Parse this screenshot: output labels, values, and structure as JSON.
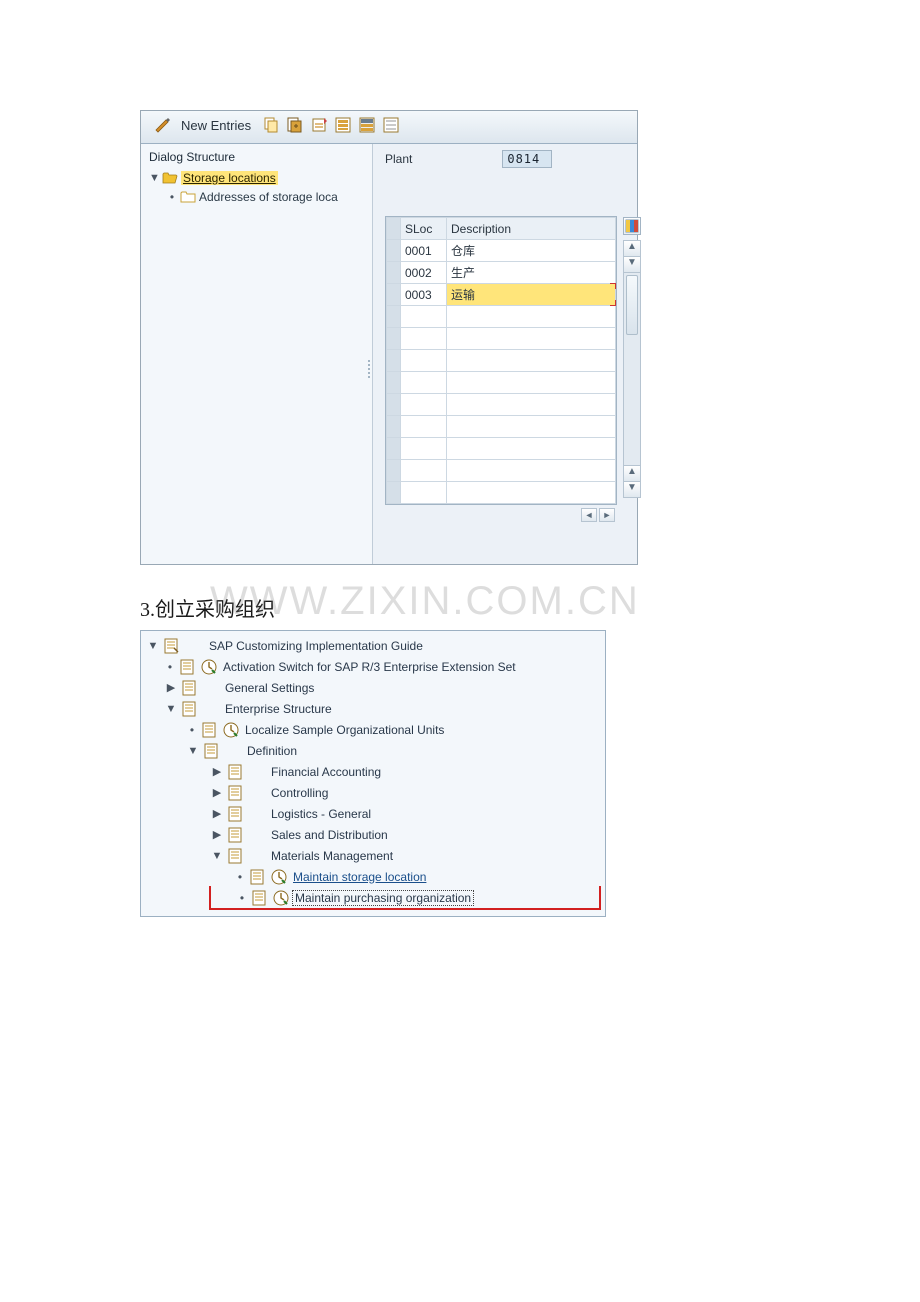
{
  "toolbar": {
    "new_entries_label": "New Entries"
  },
  "dialog_structure": {
    "title": "Dialog Structure",
    "root": "Storage locations",
    "child": "Addresses of storage loca"
  },
  "form": {
    "plant_label": "Plant",
    "plant_value": "0814"
  },
  "table": {
    "col_sloc": "SLoc",
    "col_desc": "Description",
    "rows": [
      {
        "sloc": "0001",
        "desc": "仓库"
      },
      {
        "sloc": "0002",
        "desc": "生产"
      },
      {
        "sloc": "0003",
        "desc": "运输"
      }
    ]
  },
  "section3": {
    "number": "3.",
    "title": "创立采购组织"
  },
  "watermark": "WWW.ZIXIN.COM.CN",
  "img_tree": {
    "n0": "SAP Customizing Implementation Guide",
    "n1": "Activation Switch for SAP R/3 Enterprise Extension Set",
    "n2": "General Settings",
    "n3": "Enterprise Structure",
    "n4": "Localize Sample Organizational Units",
    "n5": "Definition",
    "n6": "Financial Accounting",
    "n7": "Controlling",
    "n8": "Logistics - General",
    "n9": "Sales and Distribution",
    "n10": "Materials Management",
    "n11": "Maintain storage location",
    "n12": "Maintain purchasing organization"
  }
}
